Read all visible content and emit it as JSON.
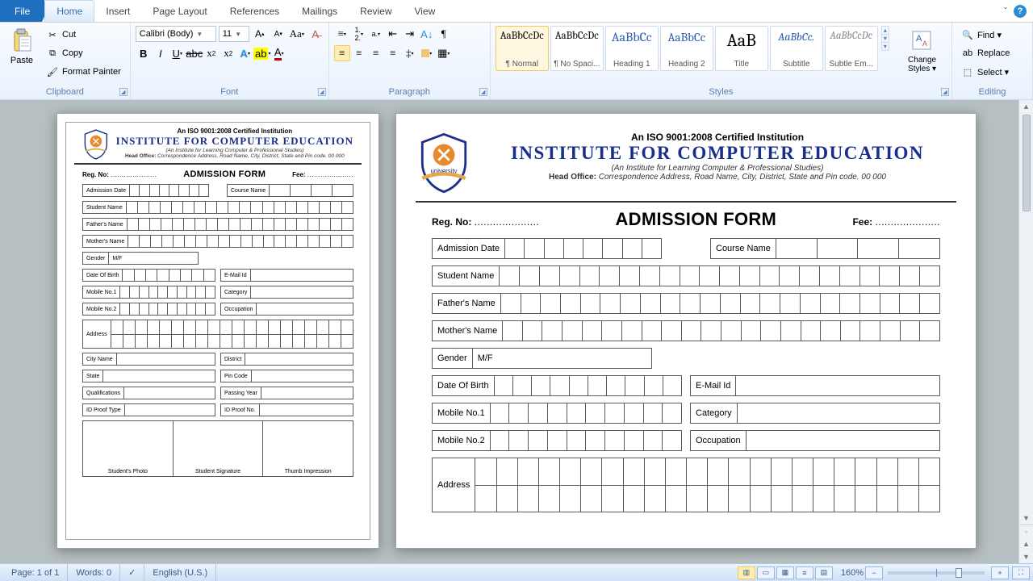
{
  "tabs": {
    "file": "File",
    "home": "Home",
    "insert": "Insert",
    "pagelayout": "Page Layout",
    "references": "References",
    "mailings": "Mailings",
    "review": "Review",
    "view": "View"
  },
  "clipboard": {
    "paste": "Paste",
    "cut": "Cut",
    "copy": "Copy",
    "fmt": "Format Painter",
    "group": "Clipboard"
  },
  "font": {
    "name": "Calibri (Body)",
    "size": "11",
    "group": "Font"
  },
  "paragraph": {
    "group": "Paragraph"
  },
  "styles": {
    "group": "Styles",
    "change": "Change Styles ▾",
    "items": [
      {
        "sample": "AaBbCcDc",
        "label": "¶ Normal",
        "sel": true,
        "sz": "13",
        "color": "#000"
      },
      {
        "sample": "AaBbCcDc",
        "label": "¶ No Spaci...",
        "sz": "13",
        "color": "#000"
      },
      {
        "sample": "AaBbCc",
        "label": "Heading 1",
        "sz": "16",
        "color": "#2a5db0"
      },
      {
        "sample": "AaBbCc",
        "label": "Heading 2",
        "sz": "15",
        "color": "#2a5db0"
      },
      {
        "sample": "AaB",
        "label": "Title",
        "sz": "22",
        "color": "#000"
      },
      {
        "sample": "AaBbCc.",
        "label": "Subtitle",
        "sz": "14",
        "color": "#2a5db0",
        "it": true
      },
      {
        "sample": "AaBbCcDc",
        "label": "Subtle Em...",
        "sz": "13",
        "color": "#888",
        "it": true
      }
    ]
  },
  "editing": {
    "find": "Find ▾",
    "replace": "Replace",
    "select": "Select ▾",
    "group": "Editing"
  },
  "doc": {
    "cert": "An ISO 9001:2008 Certified Institution",
    "title": "INSTITUTE FOR COMPUTER EDUCATION",
    "sub": "(An Institute for Learning Computer & Professional Studies)",
    "hoff_lbl": "Head Office:",
    "hoff": "Correspondence Address, Road Name, City, District, State and Pin code. 00 000",
    "reg": "Reg. No:",
    "fee": "Fee:",
    "dots": ".....................",
    "formtitle": "ADMISSION FORM",
    "fields": {
      "admission": "Admission Date",
      "course": "Course Name",
      "student": "Student Name",
      "father": "Father's Name",
      "mother": "Mother's Name",
      "gender": "Gender",
      "mf": "M/F",
      "dob": "Date Of Birth",
      "email": "E-Mail Id",
      "mob1": "Mobile No.1",
      "category": "Category",
      "mob2": "Mobile No.2",
      "occupation": "Occupation",
      "address": "Address",
      "city": "City Name",
      "district": "District",
      "state": "State",
      "pin": "Pin Code",
      "qual": "Qualifications",
      "pass": "Passing Year",
      "idtype": "ID Proof Type",
      "idno": "ID Proof No.",
      "photo": "Student's Photo",
      "sig": "Student Signature",
      "thumb": "Thumb Impression"
    }
  },
  "status": {
    "page": "Page: 1 of 1",
    "words": "Words: 0",
    "lang": "English (U.S.)",
    "zoom": "160%"
  }
}
